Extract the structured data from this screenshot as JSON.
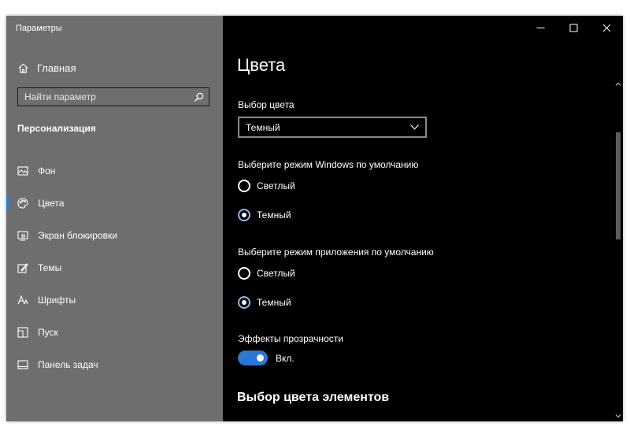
{
  "window": {
    "title": "Параметры"
  },
  "sidebar": {
    "home_label": "Главная",
    "search_placeholder": "Найти параметр",
    "section_title": "Персонализация",
    "items": [
      {
        "label": "Фон",
        "icon": "image-icon"
      },
      {
        "label": "Цвета",
        "icon": "palette-icon",
        "selected": true
      },
      {
        "label": "Экран блокировки",
        "icon": "lock-screen-icon"
      },
      {
        "label": "Темы",
        "icon": "themes-icon"
      },
      {
        "label": "Шрифты",
        "icon": "fonts-icon"
      },
      {
        "label": "Пуск",
        "icon": "start-icon"
      },
      {
        "label": "Панель задач",
        "icon": "taskbar-icon"
      }
    ]
  },
  "content": {
    "title": "Цвета",
    "color_choice": {
      "label": "Выбор цвета",
      "value": "Темный"
    },
    "windows_mode": {
      "label": "Выберите режим Windows по умолчанию",
      "options": [
        "Светлый",
        "Темный"
      ],
      "selected": "Темный"
    },
    "app_mode": {
      "label": "Выберите режим приложения по умолчанию",
      "options": [
        "Светлый",
        "Темный"
      ],
      "selected": "Темный"
    },
    "transparency": {
      "label": "Эффекты прозрачности",
      "state_label": "Вкл.",
      "on": true
    },
    "accent_section_title": "Выбор цвета элементов"
  },
  "colors": {
    "sidebar_bg": "#6e6e6e",
    "content_bg": "#000000",
    "accent": "#2a77d4"
  }
}
